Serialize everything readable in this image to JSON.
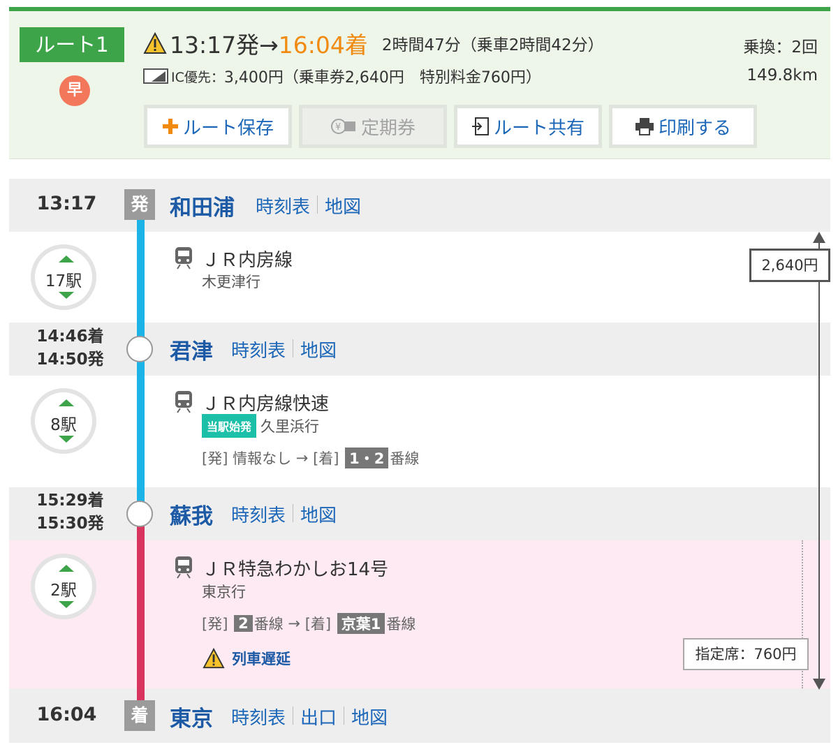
{
  "summary": {
    "route_label": "ルート1",
    "fast_badge": "早",
    "dep": "13:17発→",
    "arr": "16:04着",
    "duration": "2時間47分（乗車2時間42分）",
    "transfer": "乗換：2回",
    "fare_label": "IC優先：",
    "fare_text": "3,400円（乗車券2,640円　特別料金760円）",
    "distance": "149.8km",
    "buttons": {
      "save": "ルート保存",
      "commuter": "定期券",
      "share": "ルート共有",
      "print": "印刷する"
    }
  },
  "stations": [
    {
      "time": "13:17",
      "mark": "発",
      "name": "和田浦",
      "links": [
        "時刻表",
        "地図"
      ]
    },
    {
      "time_arr": "14:46着",
      "time_dep": "14:50発",
      "name": "君津",
      "links": [
        "時刻表",
        "地図"
      ]
    },
    {
      "time_arr": "15:29着",
      "time_dep": "15:30発",
      "name": "蘇我",
      "links": [
        "時刻表",
        "地図"
      ]
    },
    {
      "time": "16:04",
      "mark": "着",
      "name": "東京",
      "links": [
        "時刻表",
        "出口",
        "地図"
      ]
    }
  ],
  "segments": [
    {
      "stops": "17駅",
      "line": "ＪＲ内房線",
      "dest": "木更津行"
    },
    {
      "stops": "8駅",
      "line": "ＪＲ内房線快速",
      "origin_tag": "当駅始発",
      "dest": "久里浜行",
      "pf_dep_label": "[発]",
      "pf_dep": "情報なし",
      "arrow": "→",
      "pf_arr_label": "[着]",
      "pf_arr": "1・2",
      "pf_suffix": "番線"
    },
    {
      "stops": "2駅",
      "line": "ＪＲ特急わかしお14号",
      "dest": "東京行",
      "pf_dep_label": "[発]",
      "pf_dep": "2",
      "pf_dep_suffix": "番線",
      "arrow": "→",
      "pf_arr_label": "[着]",
      "pf_arr": "京葉1",
      "pf_suffix": "番線",
      "delay": "列車遅延"
    }
  ],
  "fares": {
    "ticket": "2,640円",
    "seat": "指定席：760円"
  },
  "colors": {
    "green": "#3ea44a",
    "blue_line": "#1cb3e6",
    "red_line": "#d9345e",
    "arrive_orange": "#f08a10",
    "link_blue": "#1d67b8"
  }
}
